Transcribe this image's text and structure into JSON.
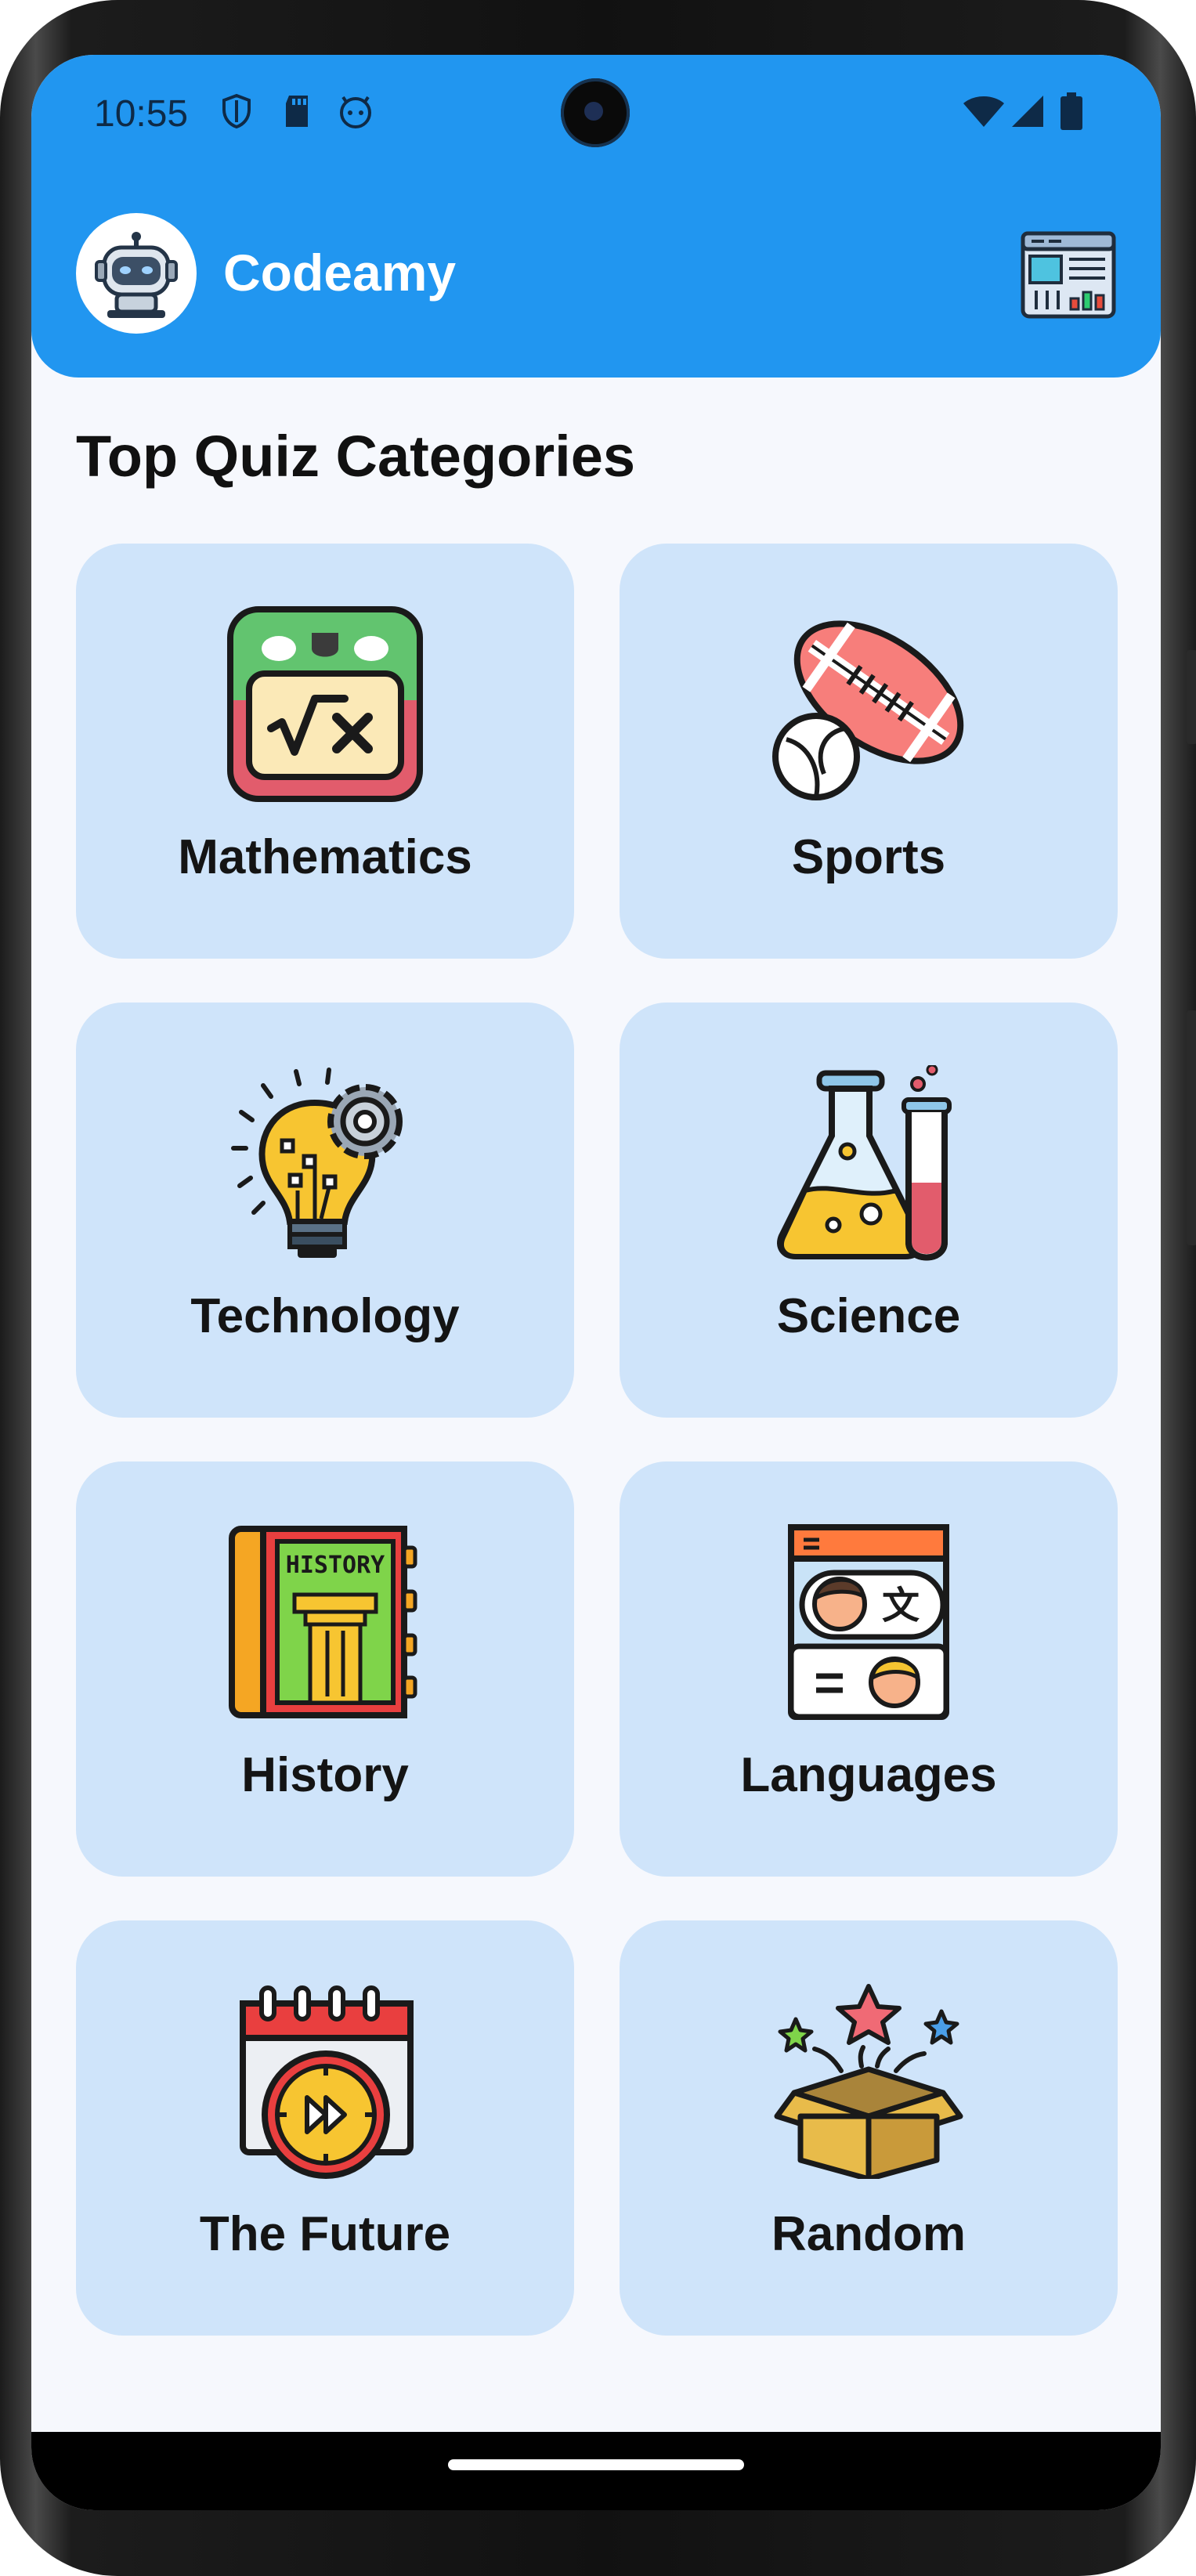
{
  "status_bar": {
    "time": "10:55"
  },
  "app_bar": {
    "title": "Codeamy"
  },
  "main": {
    "section_title": "Top Quiz Categories",
    "categories": [
      {
        "label": "Mathematics",
        "icon": "math-calculator-icon"
      },
      {
        "label": "Sports",
        "icon": "sports-balls-icon"
      },
      {
        "label": "Technology",
        "icon": "lightbulb-gear-icon"
      },
      {
        "label": "Science",
        "icon": "flask-test-tube-icon"
      },
      {
        "label": "History",
        "icon": "history-book-icon"
      },
      {
        "label": "Languages",
        "icon": "translate-chat-icon"
      },
      {
        "label": "The Future",
        "icon": "calendar-fast-forward-icon"
      },
      {
        "label": "Random",
        "icon": "mystery-box-icon"
      }
    ]
  },
  "colors": {
    "app_bar": "#2196f0",
    "card": "#cfe4fa",
    "background": "#f6f8fd"
  }
}
